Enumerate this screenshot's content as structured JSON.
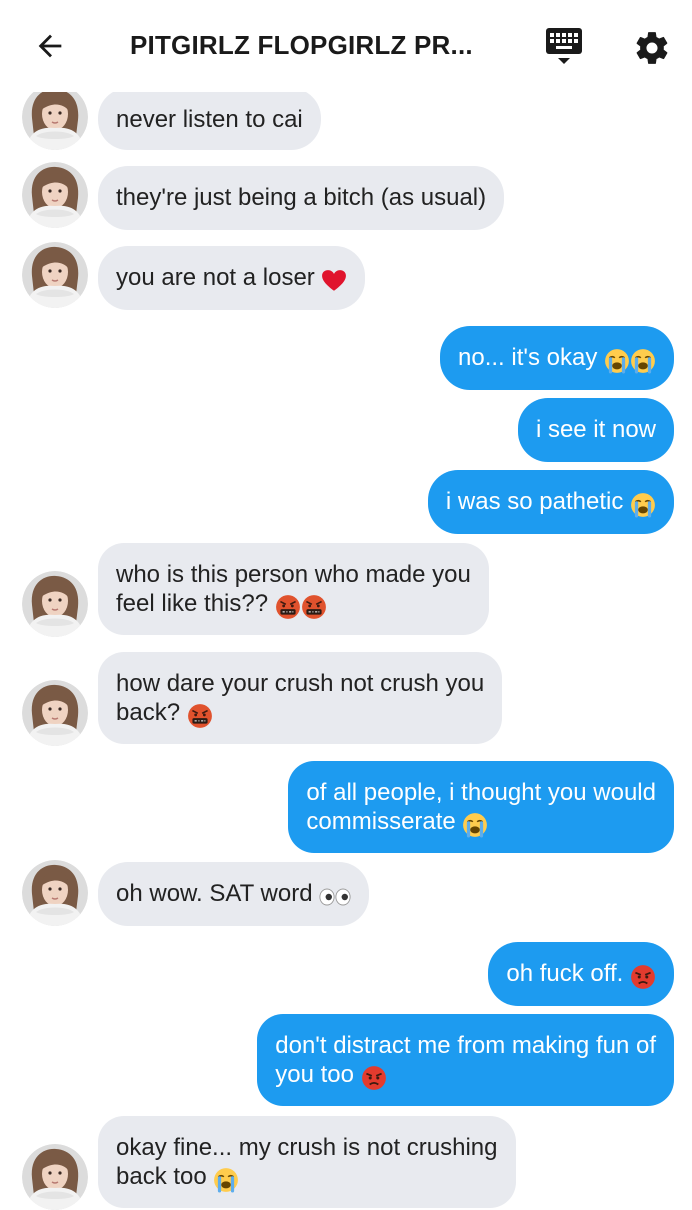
{
  "header": {
    "title": "PITGIRLZ FLOPGIRLZ PR...",
    "back_icon": "arrow-left-icon",
    "keyboard_icon": "keyboard-icon",
    "settings_icon": "gear-icon"
  },
  "colors": {
    "outgoing_bubble": "#1d9bf0",
    "incoming_bubble": "#e8eaef",
    "header_icon": "#1a1a1a"
  },
  "messages": [
    {
      "from": "them",
      "lines": [
        "never listen to cai"
      ]
    },
    {
      "from": "them",
      "lines": [
        "they're just being a bitch (as usual)"
      ]
    },
    {
      "from": "them",
      "lines": [
        "you are not a loser"
      ],
      "emoji": [
        "red-heart"
      ]
    },
    {
      "from": "me",
      "lines": [
        "no... it's okay"
      ],
      "emoji": [
        "loudly-crying-face",
        "loudly-crying-face"
      ]
    },
    {
      "from": "me",
      "lines": [
        "i see it now"
      ]
    },
    {
      "from": "me",
      "lines": [
        "i was so pathetic"
      ],
      "emoji": [
        "loudly-crying-face"
      ]
    },
    {
      "from": "them",
      "lines": [
        "who is this person who made you",
        "feel like this??"
      ],
      "emoji": [
        "face-with-symbols-on-mouth",
        "face-with-symbols-on-mouth"
      ]
    },
    {
      "from": "them",
      "lines": [
        "how dare your crush not crush you",
        "back?"
      ],
      "emoji": [
        "face-with-symbols-on-mouth"
      ]
    },
    {
      "from": "me",
      "lines": [
        "of all people, i thought you would",
        "commisserate"
      ],
      "emoji": [
        "loudly-crying-face"
      ]
    },
    {
      "from": "them",
      "lines": [
        "oh wow. SAT word"
      ],
      "emoji": [
        "eyes"
      ]
    },
    {
      "from": "me",
      "lines": [
        "oh fuck off."
      ],
      "emoji": [
        "pouting-face"
      ]
    },
    {
      "from": "me",
      "lines": [
        "don't distract me from making fun of",
        "you too"
      ],
      "emoji": [
        "pouting-face"
      ]
    },
    {
      "from": "them",
      "lines": [
        "okay fine... my crush is not crushing",
        "back too"
      ],
      "emoji": [
        "loudly-crying-face"
      ]
    }
  ]
}
